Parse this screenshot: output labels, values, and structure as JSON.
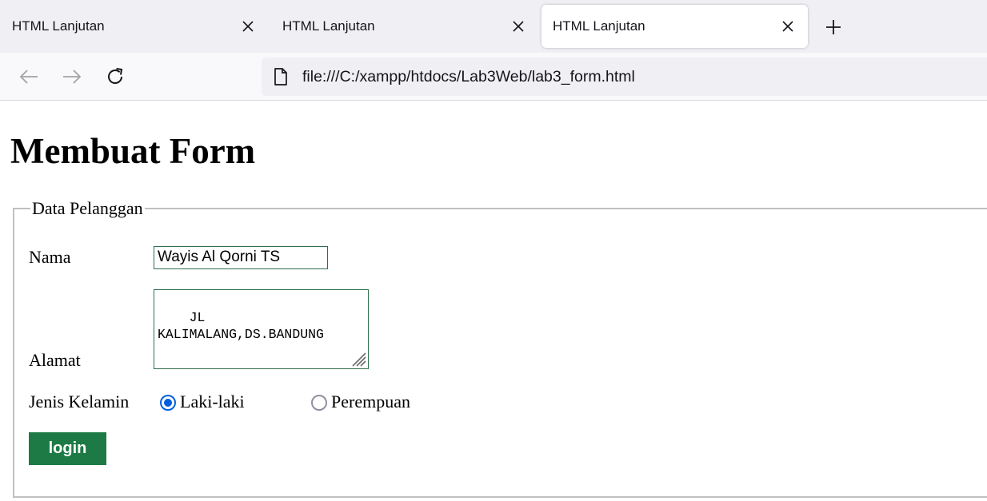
{
  "browser": {
    "tabs": [
      {
        "title": "HTML Lanjutan",
        "active": false
      },
      {
        "title": "HTML Lanjutan",
        "active": false
      },
      {
        "title": "HTML Lanjutan",
        "active": true
      }
    ],
    "url": "file:///C:/xampp/htdocs/Lab3Web/lab3_form.html",
    "icons": {
      "close": "close-icon",
      "new_tab": "plus-icon",
      "back": "arrow-left-icon",
      "forward": "arrow-right-icon",
      "reload": "reload-icon",
      "page": "document-icon"
    }
  },
  "page": {
    "title": "Membuat Form",
    "fieldset": {
      "legend": "Data Pelanggan",
      "name_label": "Nama",
      "name_value": "Wayis Al Qorni TS",
      "address_label": "Alamat",
      "address_value": "JL\nKALIMALANG,DS.BANDUNG",
      "gender_label": "Jenis Kelamin",
      "gender_options": [
        {
          "label": "Laki-laki",
          "checked": true
        },
        {
          "label": "Perempuan",
          "checked": false
        }
      ],
      "submit_label": "login"
    }
  },
  "colors": {
    "accent_radio": "#0060df",
    "button_bg": "#1e7a45",
    "input_border": "#2e6f4e"
  }
}
